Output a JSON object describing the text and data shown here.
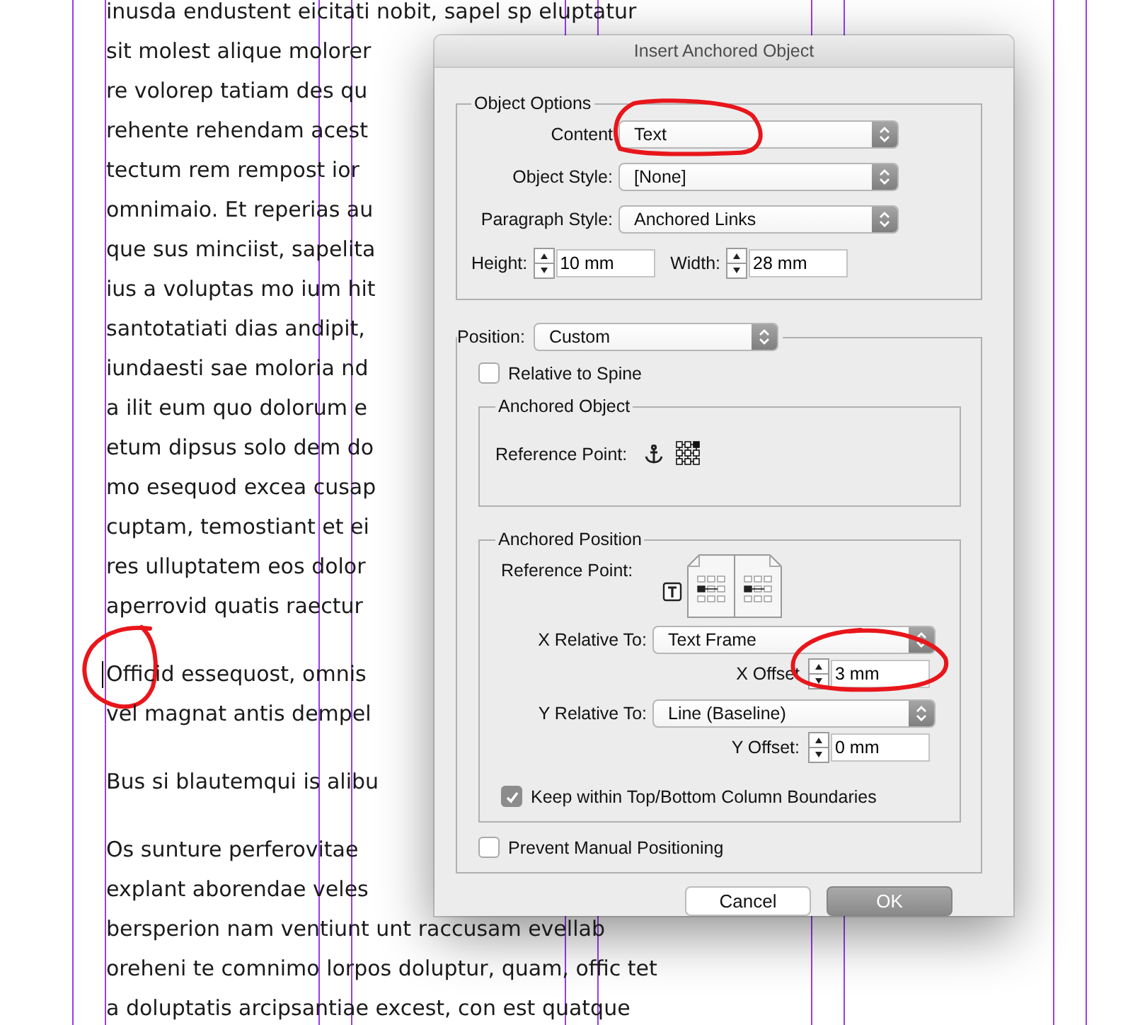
{
  "document": {
    "paragraphs": [
      {
        "lines": [
          "inusda endustent eicitati nobit, sapel sp eluptatur",
          "sit molest alique molorer",
          "re volorep tatiam des qu",
          "rehente rehendam acest",
          "tectum rem rempost ior",
          "omnimaio. Et reperias au",
          "que sus minciist, sapelita",
          "ius a voluptas mo ium hit",
          "santotatiati dias andipit,",
          "iundaesti sae moloria nd",
          "a ilit eum quo dolorum e",
          "etum dipsus solo dem do",
          "mo esequod excea cusap",
          "cuptam, temostiant et ei",
          "res ulluptatem eos dolor",
          "aperrovid quatis raectur"
        ]
      },
      {
        "lines": [
          "Officid essequost, omnis",
          "vel magnat antis dempel"
        ]
      },
      {
        "lines": [
          "Bus si blautemqui is alibu"
        ]
      },
      {
        "lines": [
          "Os sunture perferovitae",
          "explant aborendae veles",
          "bersperion nam ventiunt unt raccusam evellab",
          "oreheni te comnimo lorpos doluptur, quam, offic tet",
          "a doluptatis arcipsantiae excest, con est quatque"
        ]
      }
    ]
  },
  "dialog": {
    "title": "Insert Anchored Object",
    "object_options": {
      "legend": "Object Options",
      "selects": [
        {
          "label": "Content",
          "value": "Text"
        },
        {
          "label": "Object Style:",
          "value": "[None]"
        },
        {
          "label": "Paragraph Style:",
          "value": "Anchored Links"
        }
      ],
      "fields": [
        {
          "label": "Height:",
          "value": "10 mm"
        },
        {
          "label": "Width:",
          "value": "28 mm"
        }
      ]
    },
    "position": {
      "label": "Position:",
      "value": "Custom",
      "relative_to_spine": {
        "label": "Relative to Spine",
        "checked": false
      },
      "anchored_object": {
        "legend": "Anchored Object",
        "reference_point_label": "Reference Point:"
      },
      "anchored_position": {
        "legend": "Anchored Position",
        "reference_point_label": "Reference Point:",
        "rows": [
          {
            "kind": "select",
            "label": "X Relative To:",
            "value": "Text Frame"
          },
          {
            "kind": "field",
            "label": "X Offset",
            "value": "3 mm"
          },
          {
            "kind": "select",
            "label": "Y Relative To:",
            "value": "Line (Baseline)"
          },
          {
            "kind": "field",
            "label": "Y Offset:",
            "value": "0 mm"
          }
        ],
        "keep_within": {
          "label": "Keep within Top/Bottom Column Boundaries",
          "checked": true
        }
      },
      "prevent_manual": {
        "label": "Prevent Manual Positioning",
        "checked": false
      }
    },
    "buttons": [
      {
        "label": "Cancel",
        "kind": "secondary"
      },
      {
        "label": "OK",
        "kind": "default"
      }
    ]
  }
}
